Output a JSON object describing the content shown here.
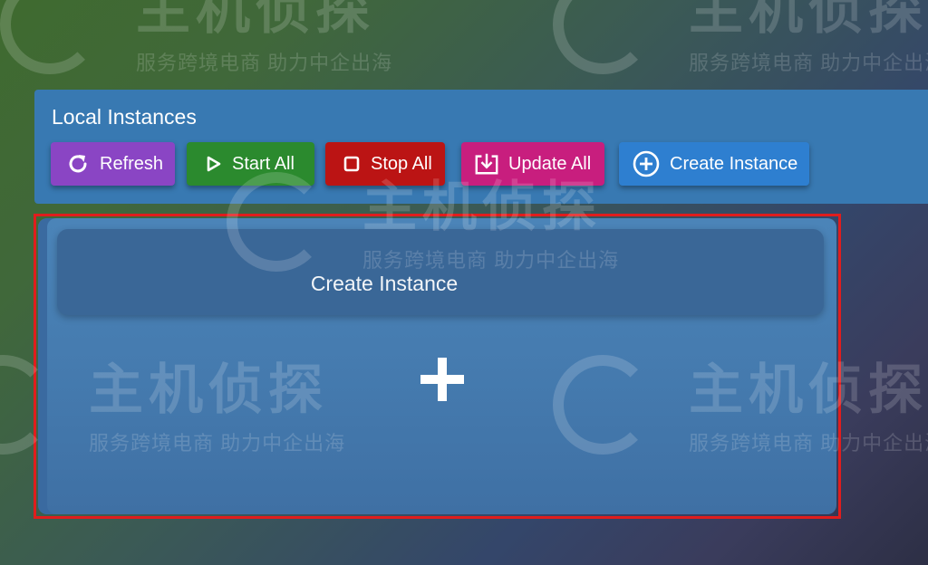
{
  "watermark": {
    "title": "主机侦探",
    "subtitle": "服务跨境电商 助力中企出海"
  },
  "panel": {
    "title": "Local Instances"
  },
  "toolbar": {
    "refresh": {
      "label": "Refresh",
      "icon": "refresh-icon",
      "color": "#8a45c4"
    },
    "start_all": {
      "label": "Start All",
      "icon": "play-icon",
      "color": "#2b8a2e"
    },
    "stop_all": {
      "label": "Stop All",
      "icon": "stop-icon",
      "color": "#bb1414"
    },
    "update_all": {
      "label": "Update All",
      "icon": "download-icon",
      "color": "#c81e7e"
    },
    "create_instance": {
      "label": "Create Instance",
      "icon": "plus-circle-icon",
      "color": "#2e7fd0"
    }
  },
  "card": {
    "header_label": "Create Instance",
    "icon": "plus-icon",
    "highlight_color": "#e01d1d"
  }
}
